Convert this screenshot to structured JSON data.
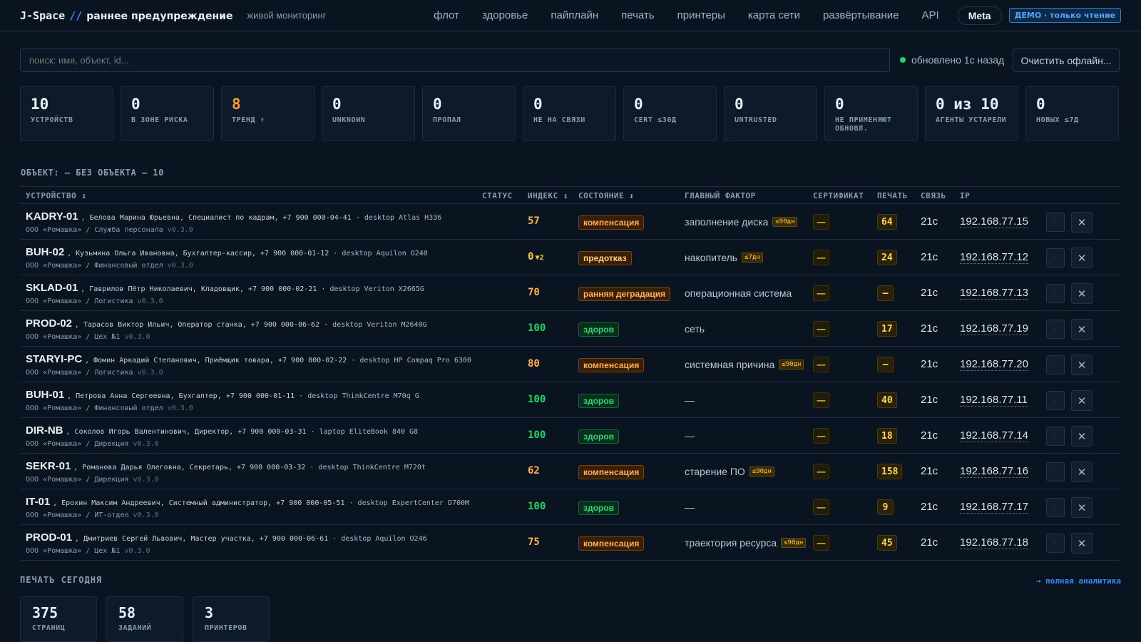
{
  "header": {
    "logo": "J-Space",
    "logo_sep": "//",
    "title": "раннее предупреждение",
    "subtitle": "живой мониторинг",
    "nav": [
      "флот",
      "здоровье",
      "пайплайн",
      "печать",
      "принтеры",
      "карта сети",
      "развёртывание",
      "API"
    ],
    "meta_label": "Meta",
    "demo_badge": "ДЕМО · только чтение"
  },
  "search": {
    "placeholder": "поиск: имя, объект, id...",
    "updated_text": "обновлено 1с назад",
    "status_color": "#1ed760",
    "clear_label": "Очистить офлайн..."
  },
  "stats": [
    {
      "value": "10",
      "label": "УСТРОЙСТВ"
    },
    {
      "value": "0",
      "label": "В ЗОНЕ РИСКА"
    },
    {
      "value": "8",
      "label": "ТРЕНД ↑"
    },
    {
      "value": "0",
      "label": "UNKNOWN"
    },
    {
      "value": "0",
      "label": "ПРОПАЛ"
    },
    {
      "value": "0",
      "label": "НЕ НА СВЯЗИ"
    },
    {
      "value": "0",
      "label": "CERT ≤30Д"
    },
    {
      "value": "0",
      "label": "UNTRUSTED"
    },
    {
      "value": "0",
      "label": "НЕ ПРИМЕНЯЮТ ОБНОВЛ."
    },
    {
      "value": "0 из 10",
      "label": "АГЕНТЫ УСТАРЕЛИ"
    },
    {
      "value": "0",
      "label": "НОВЫХ ≤7Д"
    }
  ],
  "section_label": "ОБЪЕКТ: — БЕЗ ОБЪЕКТА — 10",
  "table": {
    "headers": {
      "device": "УСТРОЙСТВО ↕",
      "status": "СТАТУС",
      "index": "ИНДЕКС ↕",
      "state": "СОСТОЯНИЕ ↕",
      "factor": "ГЛАВНЫЙ ФАКТОР",
      "cert": "СЕРТИФИКАТ",
      "print": "ПЕЧАТЬ",
      "conn": "СВЯЗЬ",
      "ip": "IP"
    },
    "rows": [
      {
        "name": "KADRY-01",
        "owner": ", Белова Марина Юрьевна, Специалист по кадрам, +7 900 000-04-41",
        "model": " · desktop Atlas H336",
        "org": "ООО «Ромашка» / Служба персонала",
        "version": "v0.3.0",
        "index": "57",
        "index_delta": "",
        "state": "компенсация",
        "factor": "заполнение диска",
        "factor_tag": "≤90дн",
        "cert": "—",
        "print": "64",
        "conn": "21с",
        "ip": "192.168.77.15"
      },
      {
        "name": "BUH-02",
        "owner": ", Кузьмина Ольга Ивановна, Бухгалтер-кассир, +7 900 000-01-12",
        "model": " · desktop Aquilon O240",
        "org": "ООО «Ромашка» / Финансовый отдел",
        "version": "v0.3.0",
        "index": "0",
        "index_delta": "▼2",
        "state": "предотказ",
        "factor": "накопитель",
        "factor_tag": "≤7дн",
        "cert": "—",
        "print": "24",
        "conn": "21с",
        "ip": "192.168.77.12"
      },
      {
        "name": "SKLAD-01",
        "owner": ", Гаврилов Пётр Николаевич, Кладовщик, +7 900 000-02-21",
        "model": " · desktop Veriton X2665G",
        "org": "ООО «Ромашка» / Логистика",
        "version": "v0.3.0",
        "index": "70",
        "index_delta": "",
        "state": "ранняя деградация",
        "factor": "операционная система",
        "factor_tag": "",
        "cert": "—",
        "print": "—",
        "conn": "21с",
        "ip": "192.168.77.13"
      },
      {
        "name": "PROD-02",
        "owner": ", Тарасов Виктор Ильич, Оператор станка, +7 900 000-06-62",
        "model": " · desktop Veriton M2640G",
        "org": "ООО «Ромашка» / Цех №1",
        "version": "v0.3.0",
        "index": "100",
        "index_delta": "",
        "state": "здоров",
        "factor": "сеть",
        "factor_tag": "",
        "cert": "—",
        "print": "17",
        "conn": "21с",
        "ip": "192.168.77.19"
      },
      {
        "name": "STARYI-PC",
        "owner": ", Фомин Аркадий Степанович, Приёмщик товара, +7 900 000-02-22",
        "model": " · desktop HP Compaq Pro 6300",
        "org": "ООО «Ромашка» / Логистика",
        "version": "v0.3.0",
        "index": "80",
        "index_delta": "",
        "state": "компенсация",
        "factor": "системная причина",
        "factor_tag": "≤90дн",
        "cert": "—",
        "print": "—",
        "conn": "21с",
        "ip": "192.168.77.20"
      },
      {
        "name": "BUH-01",
        "owner": ", Петрова Анна Сергеевна, Бухгалтер, +7 900 000-01-11",
        "model": " · desktop ThinkCentre M70q G",
        "org": "ООО «Ромашка» / Финансовый отдел",
        "version": "v0.3.0",
        "index": "100",
        "index_delta": "",
        "state": "здоров",
        "factor": "—",
        "factor_tag": "",
        "cert": "—",
        "print": "40",
        "conn": "21с",
        "ip": "192.168.77.11"
      },
      {
        "name": "DIR-NB",
        "owner": ", Соколов Игорь Валентинович, Директор, +7 900 000-03-31",
        "model": " · laptop EliteBook 840 G8",
        "org": "ООО «Ромашка» / Дирекция",
        "version": "v0.3.0",
        "index": "100",
        "index_delta": "",
        "state": "здоров",
        "factor": "—",
        "factor_tag": "",
        "cert": "—",
        "print": "18",
        "conn": "21с",
        "ip": "192.168.77.14"
      },
      {
        "name": "SEKR-01",
        "owner": ", Романова Дарья Олеговна, Секретарь, +7 900 000-03-32",
        "model": " · desktop ThinkCentre M720t",
        "org": "ООО «Ромашка» / Дирекция",
        "version": "v0.3.0",
        "index": "62",
        "index_delta": "",
        "state": "компенсация",
        "factor": "старение ПО",
        "factor_tag": "≤90дн",
        "cert": "—",
        "print": "158",
        "conn": "21с",
        "ip": "192.168.77.16"
      },
      {
        "name": "IT-01",
        "owner": ", Ерохин Максим Андреевич, Системный администратор, +7 900 000-05-51",
        "model": " · desktop ExpertCenter D700M",
        "org": "ООО «Ромашка» / ИТ-отдел",
        "version": "v0.3.0",
        "index": "100",
        "index_delta": "",
        "state": "здоров",
        "factor": "—",
        "factor_tag": "",
        "cert": "—",
        "print": "9",
        "conn": "21с",
        "ip": "192.168.77.17"
      },
      {
        "name": "PROD-01",
        "owner": ", Дмитриев Сергей Львович, Мастер участка, +7 900 000-06-61",
        "model": " · desktop Aquilon O246",
        "org": "ООО «Ромашка» / Цех №1",
        "version": "v0.3.0",
        "index": "75",
        "index_delta": "",
        "state": "компенсация",
        "factor": "траектория ресурса",
        "factor_tag": "≤90дн",
        "cert": "—",
        "print": "45",
        "conn": "21с",
        "ip": "192.168.77.18"
      }
    ]
  },
  "print_today": {
    "label": "ПЕЧАТЬ СЕГОДНЯ",
    "link": "→ полная аналитика",
    "stats": [
      {
        "value": "375",
        "label": "СТРАНИЦ"
      },
      {
        "value": "58",
        "label": "ЗАДАНИЙ"
      },
      {
        "value": "3",
        "label": "ПРИНТЕРОВ"
      }
    ]
  },
  "colors": {
    "background": "#0a1420",
    "accent": "#2f8cff",
    "warning": "#ffb340",
    "ok": "#1ed760"
  }
}
